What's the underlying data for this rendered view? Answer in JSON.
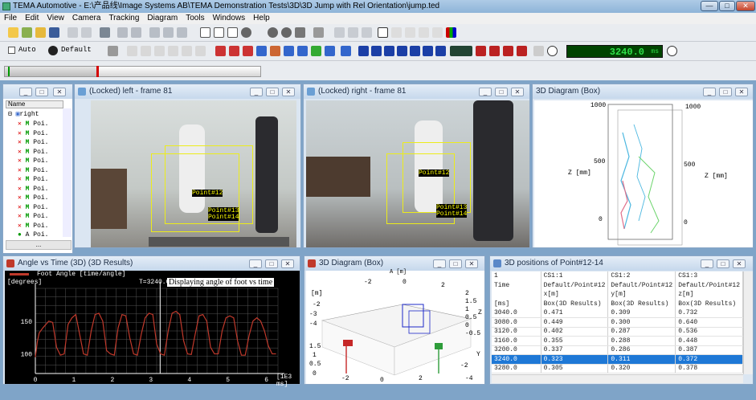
{
  "app": {
    "title": "TEMA Automotive - E:\\产品线\\Image Systems AB\\TEMA Demonstration Tests\\3D\\3D Jump with Rel Orientation\\jump.ted"
  },
  "menu": [
    "File",
    "Edit",
    "View",
    "Camera",
    "Tracking",
    "Diagram",
    "Tools",
    "Windows",
    "Help"
  ],
  "toolbar2": {
    "auto_label": "Auto",
    "default_label": "Default",
    "counter": "3240.0",
    "counter_unit": "ms"
  },
  "progress": {
    "fraction": 0.36
  },
  "tree": {
    "root": "right",
    "col_header": "Name",
    "items": [
      "Poi.",
      "Poi.",
      "Poi.",
      "Poi.",
      "Poi.",
      "Poi.",
      "Poi.",
      "Poi.",
      "Poi.",
      "Poi.",
      "Poi.",
      "Poi.",
      "Poi."
    ],
    "last_prefix": "A",
    "scroll_label": "..."
  },
  "views": {
    "left": {
      "title": "(Locked) left - frame 81",
      "labels": [
        "Point#12",
        "Point#13",
        "Point#14"
      ]
    },
    "right": {
      "title": "(Locked) right - frame 81",
      "labels": [
        "Point#12",
        "Point#13",
        "Point#14"
      ]
    }
  },
  "diag_box_top": {
    "title": "3D Diagram (Box)",
    "ticks_left": [
      "1000",
      "500",
      "0"
    ],
    "ticks_right": [
      "1000",
      "500",
      "0"
    ],
    "zlabel": "Z [mm]"
  },
  "angle": {
    "title": "Angle vs Time (3D) (3D Results)",
    "legend": "Foot Angle [time/angle]",
    "yunit": "[degrees]",
    "cursor": "T=3240.0 m",
    "annotation": "Displaying angle of foot vs time",
    "xunit": "[1E3 ms]",
    "yticks": [
      "150",
      "100"
    ],
    "xticks": [
      "0",
      "1",
      "2",
      "3",
      "4",
      "5",
      "6"
    ]
  },
  "diag_box_bottom": {
    "title": "3D Diagram (Box)",
    "top_label": "A [m]",
    "top_ticks": [
      "-2",
      "0",
      "2"
    ],
    "left_unit": "[m]",
    "right_ticks": [
      "2",
      "1.5",
      "1",
      "0.5",
      "0",
      "-0.5"
    ],
    "left_ticks": [
      "-2",
      "-3",
      "-4",
      "1.5",
      "1",
      "0.5",
      "0"
    ],
    "bottom_ticks": [
      "-2",
      "0",
      "2"
    ],
    "right_axis": "Z",
    "y_axis": "Y",
    "bottom_right_ticks": [
      "-2",
      "-4"
    ]
  },
  "positions": {
    "title": "3D positions of Point#12-14",
    "header1": [
      "1",
      "CS1:1",
      "CS1:2",
      "CS1:3"
    ],
    "header2": [
      "Time",
      "Default/Point#12",
      "Default/Point#12",
      "Default/Point#12"
    ],
    "header3": [
      "",
      "x[m]",
      "y[m]",
      "z[m]"
    ],
    "header4": [
      "[ms]",
      "Box(3D Results)",
      "Box(3D Results)",
      "Box(3D Results)"
    ],
    "rows": [
      [
        "3040.0",
        "0.471",
        "0.309",
        "0.732"
      ],
      [
        "3080.0",
        "0.449",
        "0.300",
        "0.640"
      ],
      [
        "3120.0",
        "0.402",
        "0.287",
        "0.536"
      ],
      [
        "3160.0",
        "0.355",
        "0.288",
        "0.448"
      ],
      [
        "3200.0",
        "0.337",
        "0.286",
        "0.387"
      ],
      [
        "3240.0",
        "0.323",
        "0.311",
        "0.372"
      ],
      [
        "3280.0",
        "0.305",
        "0.320",
        "0.378"
      ]
    ],
    "selected": 5
  },
  "colors": {
    "accent": "#1e78d6",
    "curve": "#c0392b",
    "lcd": "#2fe04a"
  },
  "chart_data": {
    "type": "line",
    "title": "Angle vs Time (3D) (3D Results)",
    "xlabel": "[1E3 ms]",
    "ylabel": "[degrees]",
    "xlim": [
      0,
      6.3
    ],
    "ylim": [
      70,
      200
    ],
    "series": [
      {
        "name": "Foot Angle [time/angle]",
        "x": [
          0,
          0.05,
          0.1,
          0.2,
          0.35,
          0.45,
          0.55,
          0.65,
          0.75,
          0.85,
          0.95,
          1.05,
          1.15,
          1.25,
          1.35,
          1.45,
          1.55,
          1.65,
          1.75,
          1.85,
          1.95,
          2.05,
          2.15,
          2.25,
          2.35,
          2.45,
          2.55,
          2.65,
          2.75,
          2.85,
          2.95,
          3.05,
          3.15,
          3.25,
          3.35,
          3.45,
          3.55,
          3.65,
          3.75,
          3.85,
          3.95,
          4.05,
          4.15,
          4.25,
          4.35,
          4.45,
          4.55,
          4.65,
          4.75,
          4.85,
          4.95,
          5.05,
          5.15,
          5.25,
          5.35,
          5.45,
          5.55,
          5.65,
          5.75,
          5.85,
          5.95,
          6.05,
          6.15,
          6.25
        ],
        "y": [
          95,
          118,
          132,
          140,
          150,
          148,
          110,
          98,
          100,
          145,
          155,
          160,
          130,
          100,
          98,
          135,
          160,
          162,
          150,
          105,
          100,
          98,
          140,
          160,
          158,
          125,
          100,
          98,
          130,
          155,
          162,
          160,
          115,
          100,
          98,
          135,
          162,
          165,
          160,
          120,
          100,
          99,
          130,
          158,
          160,
          150,
          110,
          100,
          100,
          135,
          155,
          158,
          155,
          120,
          98,
          98,
          128,
          150,
          155,
          150,
          135,
          112,
          100,
          100
        ]
      }
    ]
  }
}
